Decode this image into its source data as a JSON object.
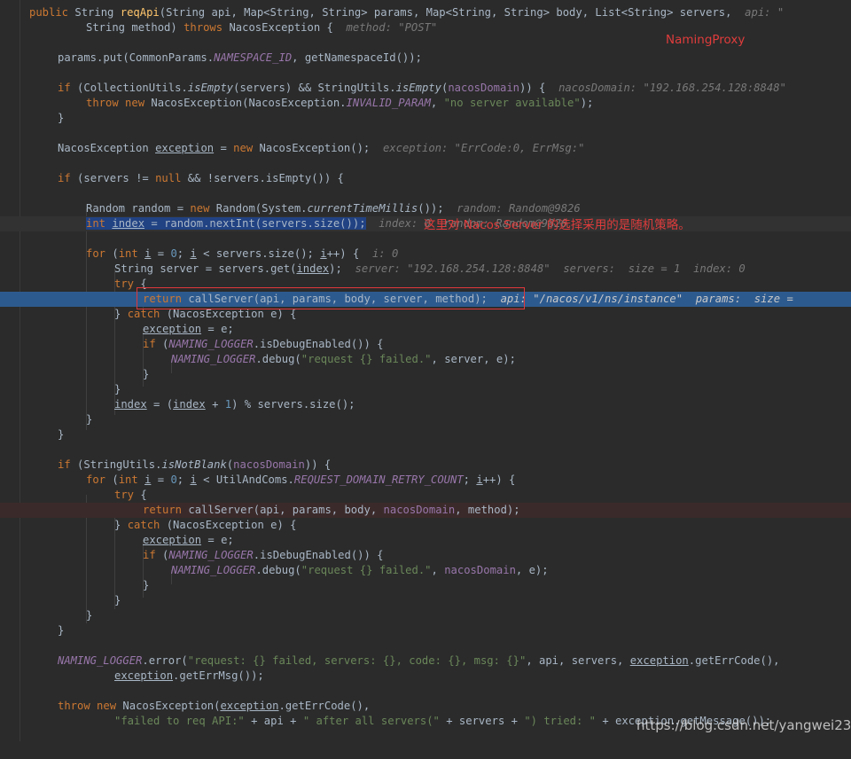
{
  "annotations": {
    "class_label": "NamingProxy",
    "strategy_note": "这里对 Nacos Server 的选择采用的是随机策略。",
    "watermark": "https://blog.csdn.net/yangwei234"
  },
  "colors": {
    "background": "#2b2b2b",
    "keyword": "#cc7832",
    "method": "#ffc66d",
    "string": "#6a8759",
    "field": "#9876aa",
    "inline_hint": "#787878",
    "execution_line": "#2d5a8e",
    "annotation_red": "#e03c3c"
  },
  "code": {
    "sig1_kw": "public",
    "sig1_type": "String",
    "sig1_name": "reqApi",
    "sig1_params": "(String api, Map<String, String> params, Map<String, String> body, List<String> servers,",
    "sig1_hint": "api: \"",
    "sig2_a": "String method)",
    "sig2_throws": "throws",
    "sig2_b": "NacosException {",
    "sig2_hint": "method: \"POST\"",
    "l3_a": "params.put(CommonParams.",
    "l3_field": "NAMESPACE_ID",
    "l3_b": ", getNamespaceId());",
    "l5_if": "if",
    "l5_a": "(CollectionUtils.",
    "l5_m1": "isEmpty",
    "l5_b": "(servers) && StringUtils.",
    "l5_m2": "isEmpty",
    "l5_c": "(",
    "l5_v": "nacosDomain",
    "l5_d": ")) {",
    "l5_hint": "nacosDomain: \"192.168.254.128:8848\"",
    "l6_throw": "throw new",
    "l6_a": "NacosException(NacosException.",
    "l6_field": "INVALID_PARAM",
    "l6_b": ",",
    "l6_str": "\"no server available\"",
    "l6_c": ");",
    "brace": "}",
    "l9_a": "NacosException",
    "l9_var": "exception",
    "l9_b": "=",
    "l9_new": "new",
    "l9_c": "NacosException();",
    "l9_hint": "exception: \"ErrCode:0, ErrMsg:\"",
    "l11_if": "if",
    "l11_a": "(servers !=",
    "l11_null": "null",
    "l11_b": "&& !servers.isEmpty()) {",
    "l13_a": "Random random =",
    "l13_new": "new",
    "l13_b": "Random(System.",
    "l13_m": "currentTimeMillis",
    "l13_c": "());",
    "l13_hint": "random: Random@9826",
    "l14_int": "int",
    "l14_var": "index",
    "l14_b": "= random.nextInt(servers.size());",
    "l14_hint": "index: 0  random: Random@9826",
    "l16_for": "for",
    "l16_a": "(",
    "l16_int": "int",
    "l16_i": "i",
    "l16_b": "=",
    "l16_zero": "0",
    "l16_c": ";",
    "l16_d": "< servers.size();",
    "l16_e": "++) {",
    "l16_hint": "i: 0",
    "l17_a": "String server = servers.get(",
    "l17_var": "index",
    "l17_b": ");",
    "l17_hint": "server: \"192.168.254.128:8848\"  servers:  size = 1  index: 0",
    "l18_try": "try",
    "l18_a": "{",
    "l19_ret": "return",
    "l19_a": "callServer(api, params, body, server, method);",
    "l19_hint": "api: \"/nacos/v1/ns/instance\"  params:  size =",
    "l20_a": "}",
    "l20_catch": "catch",
    "l20_b": "(NacosException e) {",
    "l21_var": "exception",
    "l21_b": "= e;",
    "l22_if": "if",
    "l22_a": "(",
    "l22_field": "NAMING_LOGGER",
    "l22_b": ".isDebugEnabled()) {",
    "l23_field": "NAMING_LOGGER",
    "l23_a": ".debug(",
    "l23_str": "\"request {} failed.\"",
    "l23_b": ", server, e);",
    "l26_var": "index",
    "l26_a": "= (",
    "l26_var2": "index",
    "l26_b": "+",
    "l26_one": "1",
    "l26_c": ") % servers.size();",
    "l30_if": "if",
    "l30_a": "(StringUtils.",
    "l30_m": "isNotBlank",
    "l30_b": "(",
    "l30_v": "nacosDomain",
    "l30_c": ")) {",
    "l31_for": "for",
    "l31_a": "(",
    "l31_int": "int",
    "l31_i": "i",
    "l31_b": "=",
    "l31_zero": "0",
    "l31_c": ";",
    "l31_d": "< UtilAndComs.",
    "l31_field": "REQUEST_DOMAIN_RETRY_COUNT",
    "l31_e": ";",
    "l31_f": "++) {",
    "l32_try": "try",
    "l32_a": "{",
    "l33_ret": "return",
    "l33_a": "callServer(api, params, body,",
    "l33_v": "nacosDomain",
    "l33_b": ", method);",
    "l34_a": "}",
    "l34_catch": "catch",
    "l34_b": "(NacosException e) {",
    "l35_var": "exception",
    "l35_b": "= e;",
    "l36_if": "if",
    "l36_a": "(",
    "l36_field": "NAMING_LOGGER",
    "l36_b": ".isDebugEnabled()) {",
    "l37_field": "NAMING_LOGGER",
    "l37_a": ".debug(",
    "l37_str": "\"request {} failed.\"",
    "l37_b": ",",
    "l37_v": "nacosDomain",
    "l37_c": ", e);",
    "l43_field": "NAMING_LOGGER",
    "l43_a": ".error(",
    "l43_str": "\"request: {} failed, servers: {}, code: {}, msg: {}\"",
    "l43_b": ", api, servers,",
    "l43_var": "exception",
    "l43_c": ".getErrCode(),",
    "l44_var": "exception",
    "l44_a": ".getErrMsg());",
    "l46_throw": "throw new",
    "l46_a": "NacosException(",
    "l46_var": "exception",
    "l46_b": ".getErrCode(),",
    "l47_str1": "\"failed to req API:\"",
    "l47_a": "+ api +",
    "l47_str2": "\" after all servers(\"",
    "l47_b": "+ servers +",
    "l47_str3": "\") tried: \"",
    "l47_c": "+ exception.getMessage());"
  }
}
